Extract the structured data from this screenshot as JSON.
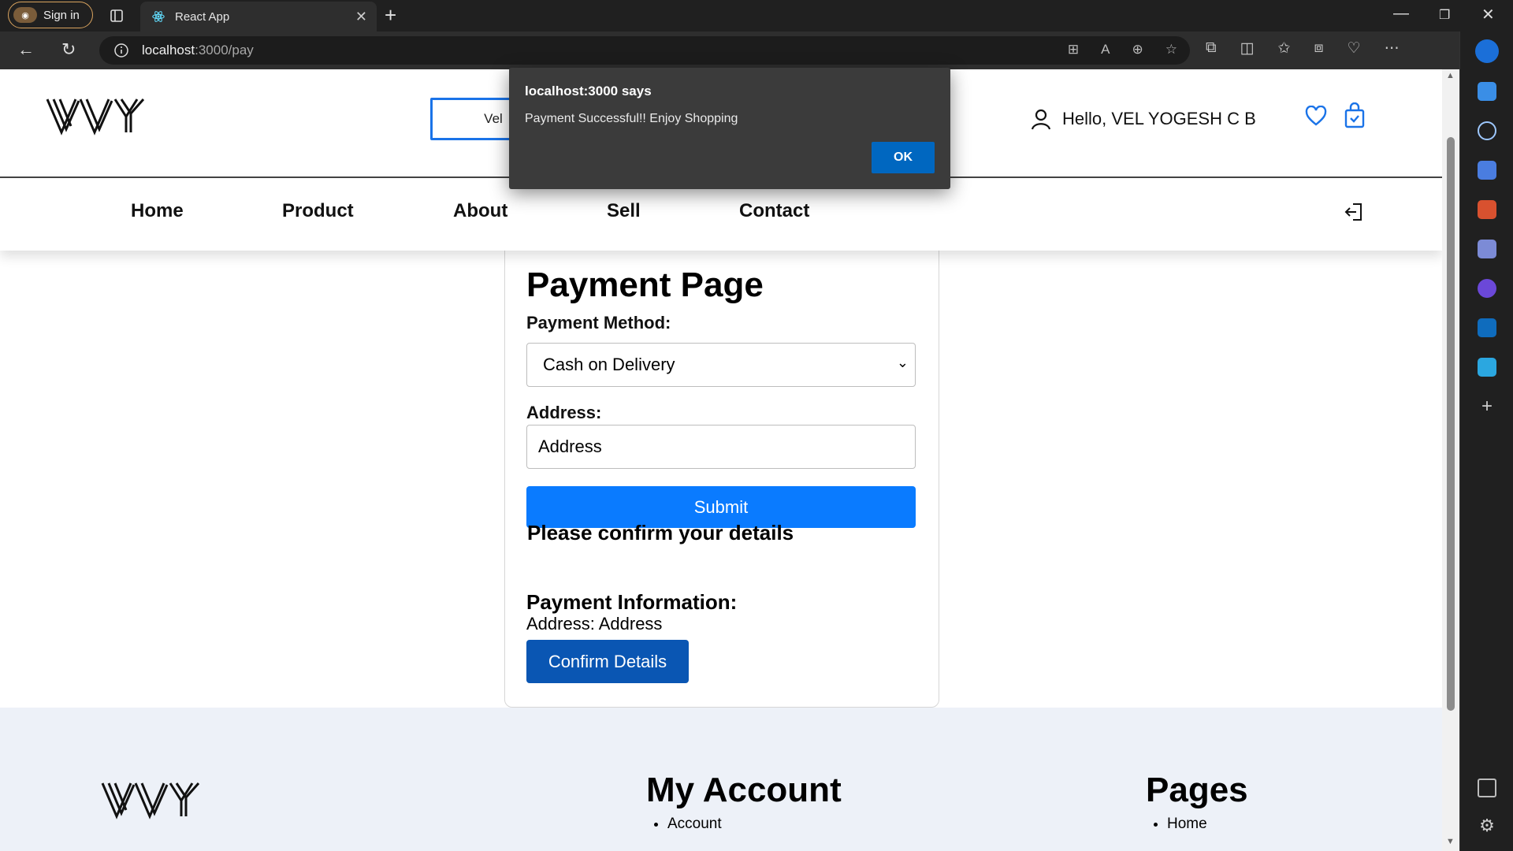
{
  "browser": {
    "signin_label": "Sign in",
    "tab_title": "React App",
    "url_host": "localhost",
    "url_path": ":3000/pay"
  },
  "header": {
    "search_value": "Vel",
    "greeting": "Hello, VEL YOGESH C B"
  },
  "nav": {
    "items": [
      "Home",
      "Product",
      "About",
      "Sell",
      "Contact"
    ]
  },
  "payment": {
    "title": "Payment Page",
    "method_label": "Payment Method:",
    "method_value": "Cash on Delivery",
    "address_label": "Address:",
    "address_value": "Address",
    "submit_label": "Submit",
    "confirm_prompt": "Please confirm your details",
    "info_heading": "Payment Information:",
    "info_address": "Address: Address",
    "confirm_button": "Confirm Details"
  },
  "footer": {
    "col1_title": "My Account",
    "col1_items": [
      "Account"
    ],
    "col2_title": "Pages",
    "col2_items": [
      "Home"
    ]
  },
  "dialog": {
    "title": "localhost:3000 says",
    "message": "Payment Successful!! Enjoy Shopping",
    "ok_label": "OK"
  },
  "colors": {
    "primary_button": "#0a7bff",
    "confirm_button": "#0a56b3",
    "search_border": "#1a73e8",
    "dialog_ok": "#0067c0"
  }
}
